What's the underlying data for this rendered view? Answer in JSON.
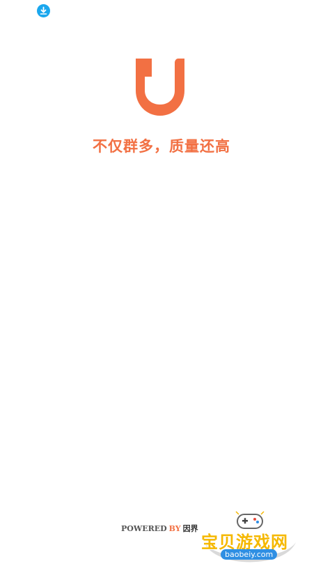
{
  "status_bar": {
    "download_icon": "download-arrow-icon",
    "download_color": "#1aa7ee"
  },
  "splash": {
    "logo_icon": "app-u-logo-icon",
    "slogan": "不仅群多，质量还高",
    "accent_color": "#f27043"
  },
  "footer": {
    "powered": "POWERED",
    "by": "BY",
    "brand": "因界"
  },
  "watermark": {
    "title": "宝贝游戏网",
    "url": "baobeiy.com",
    "icon": "gamepad-icon"
  }
}
